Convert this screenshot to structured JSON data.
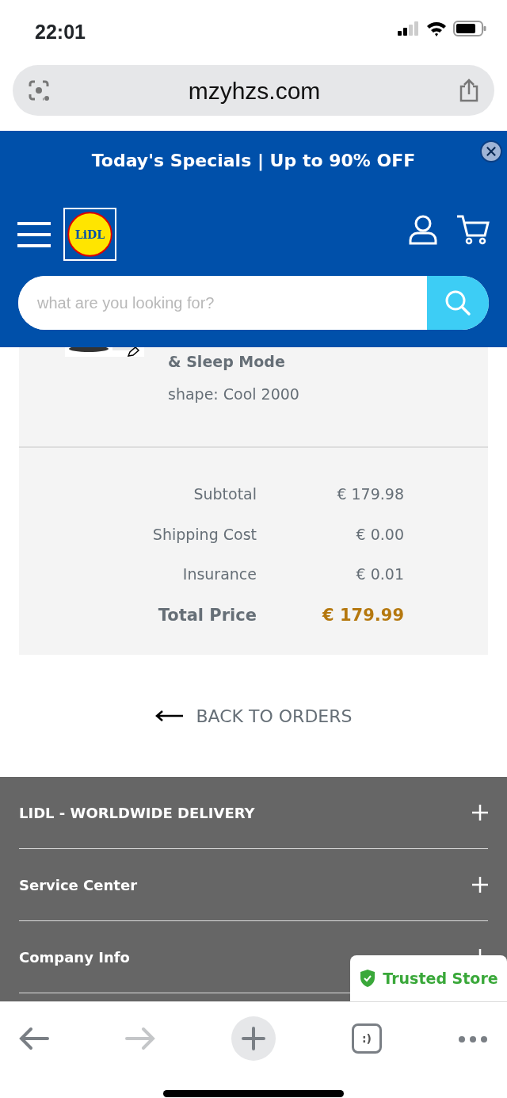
{
  "status_bar": {
    "time": "22:01"
  },
  "address_bar": {
    "url": "mzyhzs.com"
  },
  "promo_banner": {
    "text": "Today's Specials | Up to 90% OFF"
  },
  "header": {
    "logo_text": "LiDL",
    "search": {
      "placeholder": "what are you looking for?"
    }
  },
  "order_item": {
    "title_tail": "& Sleep Mode",
    "variant": "shape: Cool 2000"
  },
  "summary": [
    {
      "label": "Subtotal",
      "value": "€ 179.98",
      "kind": "line"
    },
    {
      "label": "Shipping Cost",
      "value": "€ 0.00",
      "kind": "line"
    },
    {
      "label": "Insurance",
      "value": "€ 0.01",
      "kind": "line"
    },
    {
      "label": "Total Price",
      "value": "€ 179.99",
      "kind": "total"
    }
  ],
  "back_link": "BACK TO ORDERS",
  "footer_sections": [
    {
      "label": "LIDL - WORLDWIDE DELIVERY",
      "expanded": false
    },
    {
      "label": "Service Center",
      "expanded": false
    },
    {
      "label": "Company Info",
      "expanded": false
    }
  ],
  "trust_badge": "Trusted Store",
  "browser_toolbar": {
    "forward_disabled": true,
    "tabs_label": ":)"
  }
}
